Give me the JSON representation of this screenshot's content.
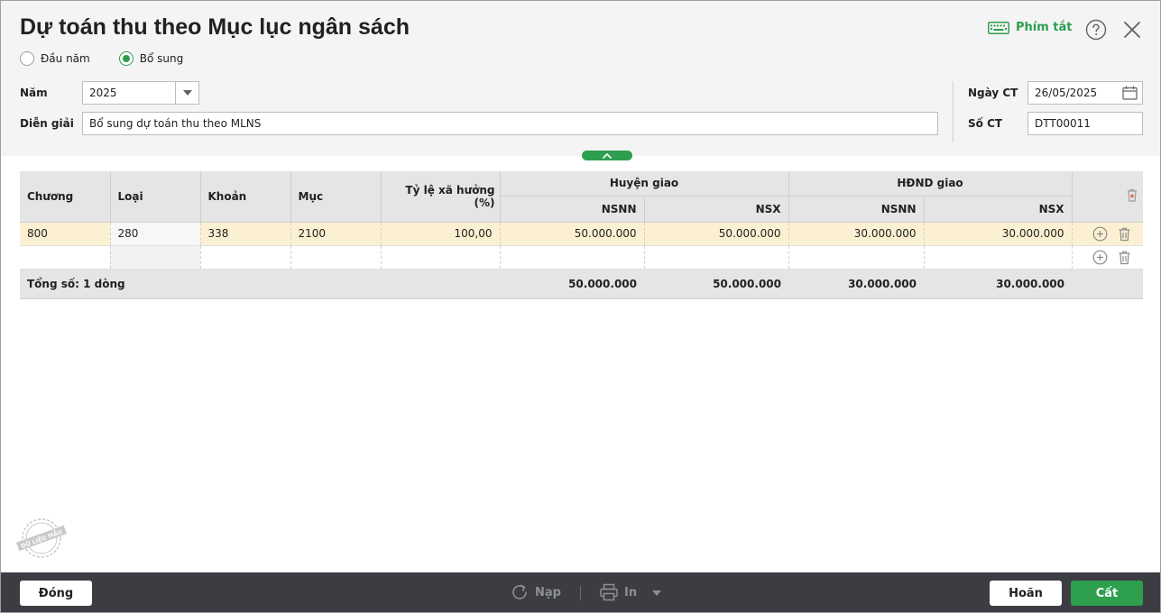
{
  "dialog": {
    "title": "Dự toán thu theo Mục lục ngân sách",
    "shortcut_label": "Phím tắt"
  },
  "mode": {
    "options": [
      {
        "label": "Đầu năm",
        "checked": false
      },
      {
        "label": "Bổ sung",
        "checked": true
      }
    ]
  },
  "form": {
    "year_label": "Năm",
    "year_value": "2025",
    "desc_label": "Diễn giải",
    "desc_value": "Bổ sung dự toán thu theo MLNS",
    "date_label": "Ngày CT",
    "date_value": "26/05/2025",
    "docno_label": "Số CT",
    "docno_value": "DTT00011"
  },
  "grid": {
    "headers": {
      "chuong": "Chương",
      "loai": "Loại",
      "khoan": "Khoản",
      "muc": "Mục",
      "tyle": "Tỷ lệ xã hưởng (%)",
      "huyen_group": "Huyện giao",
      "hdnd_group": "HĐND giao",
      "nsnn": "NSNN",
      "nsx": "NSX"
    },
    "rows": [
      {
        "chuong": "800",
        "loai": "280",
        "khoan": "338",
        "muc": "2100",
        "tyle": "100,00",
        "huyen_nsnn": "50.000.000",
        "huyen_nsx": "50.000.000",
        "hdnd_nsnn": "30.000.000",
        "hdnd_nsx": "30.000.000"
      }
    ],
    "total": {
      "label_prefix": "Tổng số: ",
      "count": "1",
      "label_suffix": " dòng",
      "huyen_nsnn": "50.000.000",
      "huyen_nsx": "50.000.000",
      "hdnd_nsnn": "30.000.000",
      "hdnd_nsx": "30.000.000"
    }
  },
  "watermark_text": "DỮ LIỆU MẪU",
  "footer": {
    "close_label": "Đóng",
    "reload_label": "Nạp",
    "print_label": "In",
    "cancel_label": "Hoãn",
    "save_label": "Cất"
  },
  "colors": {
    "accent": "#2e9e4f",
    "selected_row": "#fcf0d2",
    "footer_bg": "#3b3d42"
  }
}
